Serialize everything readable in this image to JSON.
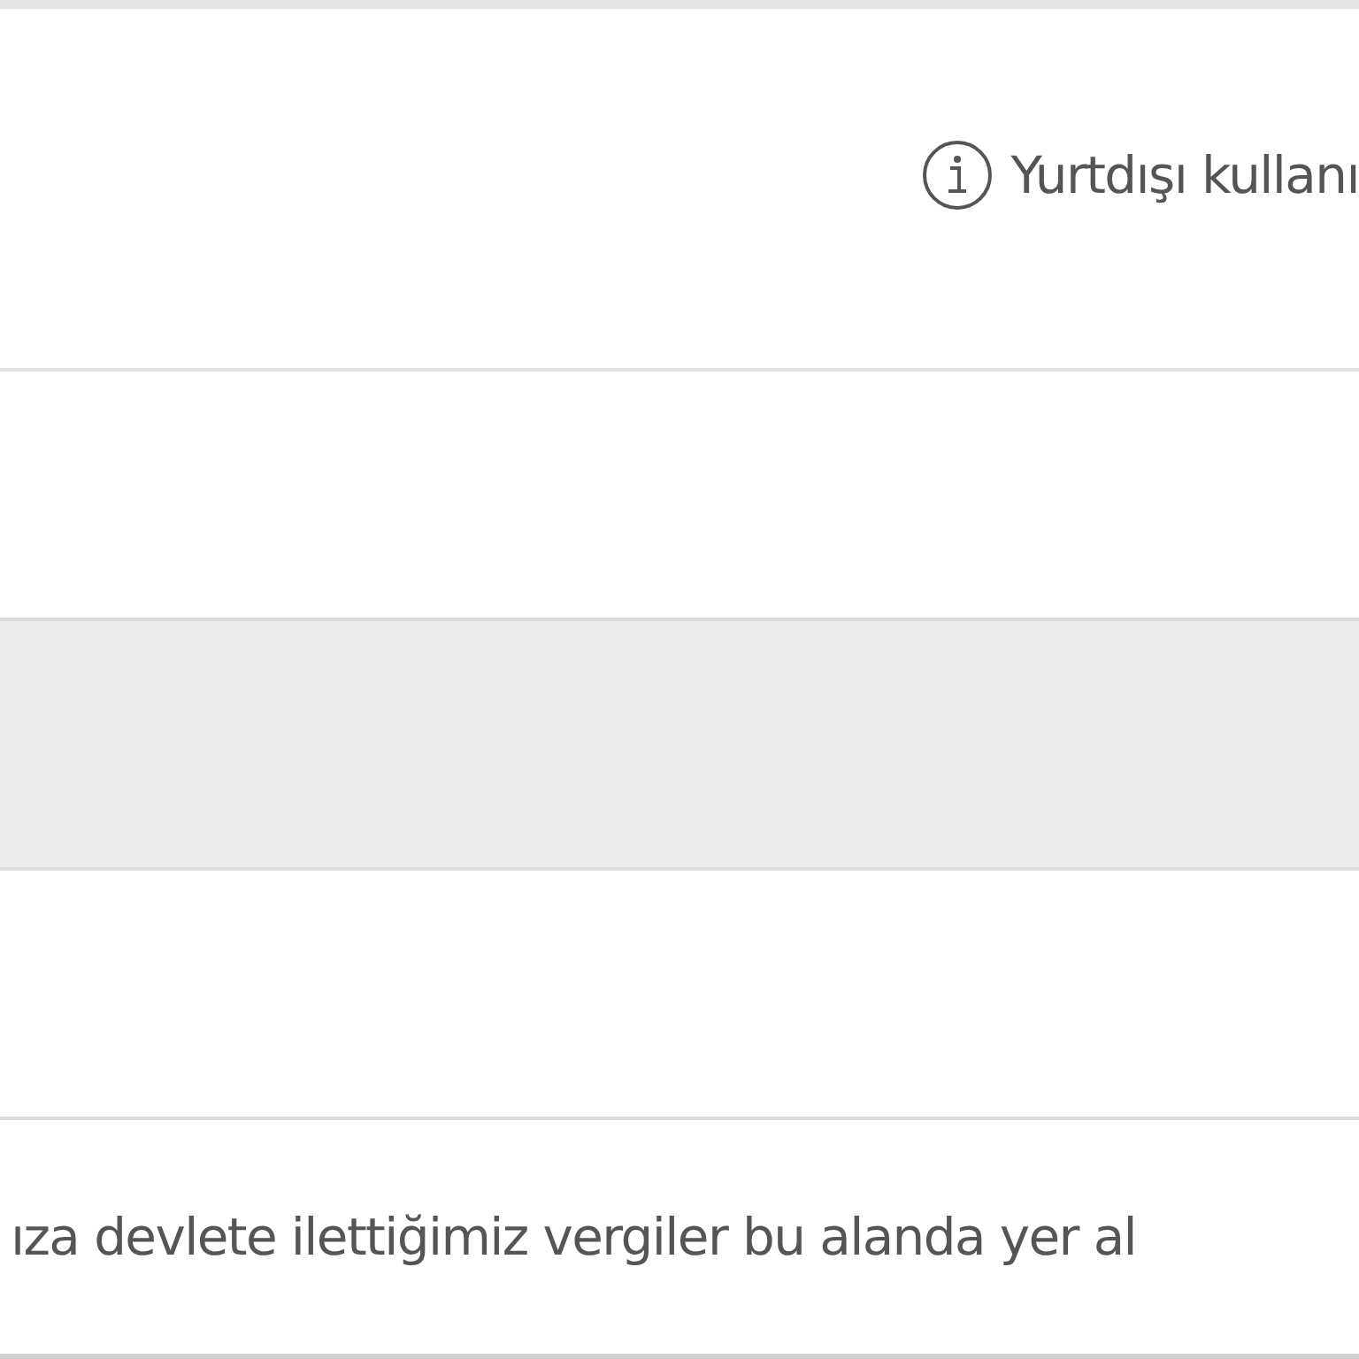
{
  "info_note": {
    "text": "Yurtdışı kullanı"
  },
  "rows": [
    {
      "kind": "plain"
    },
    {
      "kind": "shaded"
    },
    {
      "kind": "plain"
    }
  ],
  "footer_note": {
    "text": "ıza devlete ilettiğimiz vergiler bu alanda yer al"
  }
}
